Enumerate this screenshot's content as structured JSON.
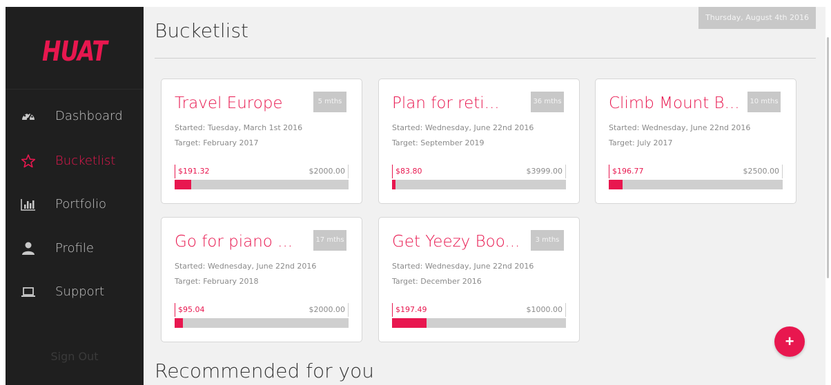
{
  "app": {
    "logo": "HUAT"
  },
  "sidebar": {
    "items": [
      {
        "label": "Dashboard",
        "icon": "dashboard-icon"
      },
      {
        "label": "Bucketlist",
        "icon": "star-icon",
        "active": true
      },
      {
        "label": "Portfolio",
        "icon": "bar-chart-icon"
      },
      {
        "label": "Profile",
        "icon": "user-icon"
      },
      {
        "label": "Support",
        "icon": "laptop-icon"
      }
    ],
    "signout": "Sign Out"
  },
  "header": {
    "title": "Bucketlist",
    "date": "Thursday, August 4th 2016"
  },
  "cards": [
    {
      "title": "Travel Europe",
      "badge": "5 mths",
      "started": "Started: Tuesday, March 1st 2016",
      "target_date": "Target: February 2017",
      "current": "$191.32",
      "target": "$2000.00",
      "progress": 0.0957
    },
    {
      "title": "Plan for reti...",
      "badge": "36 mths",
      "started": "Started: Wednesday, June 22nd 2016",
      "target_date": "Target: September 2019",
      "current": "$83.80",
      "target": "$3999.00",
      "progress": 0.021
    },
    {
      "title": "Climb Mount B...",
      "badge": "10 mths",
      "started": "Started: Wednesday, June 22nd 2016",
      "target_date": "Target: July 2017",
      "current": "$196.77",
      "target": "$2500.00",
      "progress": 0.0787
    },
    {
      "title": "Go for piano ...",
      "badge": "17 mths",
      "started": "Started: Wednesday, June 22nd 2016",
      "target_date": "Target: February 2018",
      "current": "$95.04",
      "target": "$2000.00",
      "progress": 0.0475
    },
    {
      "title": "Get Yeezy Boo...",
      "badge": "3 mths",
      "started": "Started: Wednesday, June 22nd 2016",
      "target_date": "Target: December 2016",
      "current": "$197.49",
      "target": "$1000.00",
      "progress": 0.1975
    }
  ],
  "fab": {
    "label": "+",
    "icon": "plus-icon"
  },
  "recommended": {
    "title": "Recommended for you"
  },
  "colors": {
    "accent": "#e8174f",
    "sidebar": "#1f1f1f",
    "background": "#f1f1f1"
  }
}
